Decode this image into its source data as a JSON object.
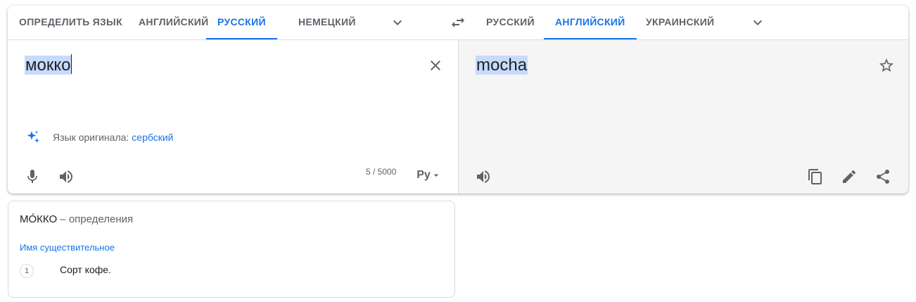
{
  "source_langs": {
    "tabs": [
      {
        "label": "Определить язык",
        "active": false
      },
      {
        "label": "Английский",
        "active": false
      },
      {
        "label": "Русский",
        "active": true
      },
      {
        "label": "Немецкий",
        "active": false
      }
    ]
  },
  "target_langs": {
    "tabs": [
      {
        "label": "Русский",
        "active": false
      },
      {
        "label": "Английский",
        "active": true
      },
      {
        "label": "Украинский",
        "active": false
      }
    ]
  },
  "source": {
    "text": "мокко",
    "detected_prefix": "Язык оригинала:",
    "detected_lang": "сербский",
    "char_count": "5 / 5000",
    "input_tool": "Ру"
  },
  "target": {
    "text": "mocha"
  },
  "definitions": {
    "word": "МО́ККО",
    "suffix": " – определения",
    "part_of_speech": "Имя существительное",
    "items": [
      {
        "num": "1",
        "text": "Сорт кофе."
      }
    ]
  },
  "colors": {
    "accent": "#1a73e8",
    "selection": "#c6dafc",
    "target_bg": "#f5f5f5"
  },
  "icons": [
    "chevron-down-icon",
    "swap-icon",
    "close-icon",
    "sparkle-icon",
    "mic-icon",
    "speaker-icon",
    "dropdown-arrow-icon",
    "star-icon",
    "copy-icon",
    "pencil-icon",
    "share-icon"
  ]
}
